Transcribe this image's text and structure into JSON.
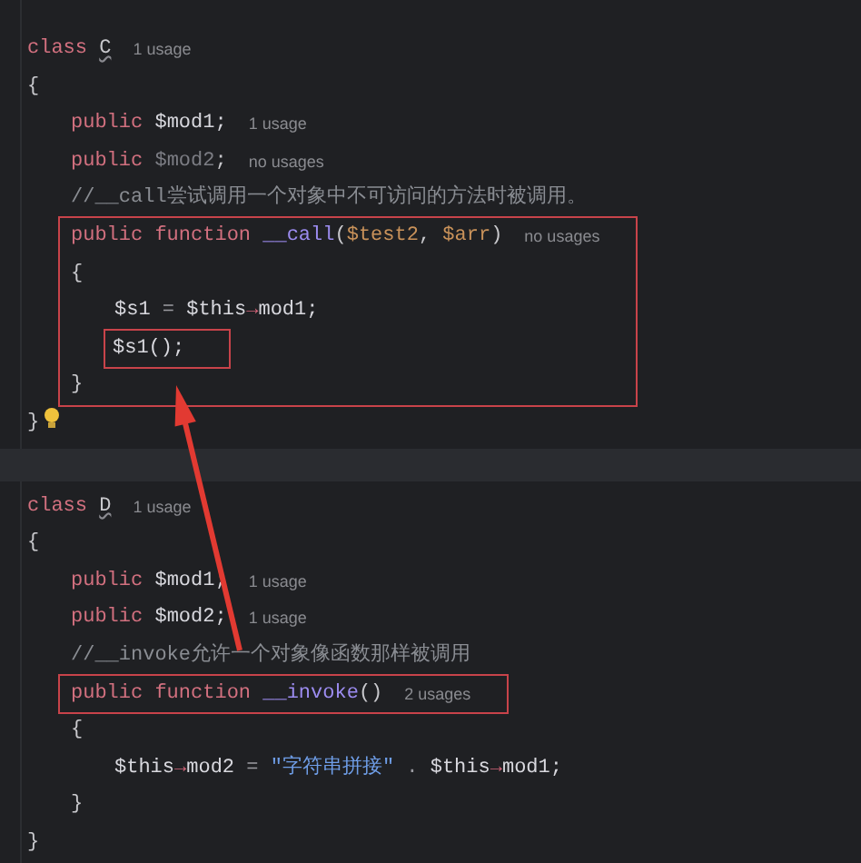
{
  "editor": {
    "blocks": [
      {
        "lines": [
          {
            "tokens": [
              {
                "kind": "keyword",
                "text": "class "
              },
              {
                "kind": "class_name",
                "text": "C"
              }
            ],
            "hint": "1 usage"
          },
          {
            "tokens": [
              {
                "kind": "plain",
                "text": "{"
              }
            ],
            "children": [
              {
                "tokens": [
                  {
                    "kind": "keyword",
                    "text": "public "
                  },
                  {
                    "kind": "var",
                    "text": "$mod1;"
                  }
                ],
                "hint": "1 usage"
              },
              {
                "tokens": [
                  {
                    "kind": "keyword",
                    "text": "public "
                  },
                  {
                    "kind": "unused",
                    "text": "$mod2"
                  },
                  {
                    "kind": "plain",
                    "text": ";"
                  }
                ],
                "hint": "no usages"
              },
              {
                "tokens": [
                  {
                    "kind": "comment",
                    "text": "//__call尝试调用一个对象中不可访问的方法时被调用。"
                  }
                ]
              },
              {
                "kind": "frame",
                "lines": [
                  {
                    "tokens": [
                      {
                        "kind": "keyword",
                        "text": "public function "
                      },
                      {
                        "kind": "function",
                        "text": "__call"
                      },
                      {
                        "kind": "plain",
                        "text": "("
                      },
                      {
                        "kind": "param",
                        "text": "$test2"
                      },
                      {
                        "kind": "plain",
                        "text": ", "
                      },
                      {
                        "kind": "param",
                        "text": "$arr"
                      },
                      {
                        "kind": "plain",
                        "text": ")"
                      }
                    ],
                    "hint": "no usages"
                  },
                  {
                    "tokens": [
                      {
                        "kind": "plain",
                        "text": "{"
                      }
                    ],
                    "children": [
                      {
                        "tokens": [
                          {
                            "kind": "var",
                            "text": "$s1 "
                          },
                          {
                            "kind": "operator",
                            "text": "= "
                          },
                          {
                            "kind": "var",
                            "text": "$this"
                          },
                          {
                            "kind": "arrow",
                            "text": "→"
                          },
                          {
                            "kind": "var",
                            "text": "mod1;"
                          }
                        ]
                      },
                      {
                        "tokens": [
                          {
                            "kind": "var",
                            "text": "$s1();"
                          }
                        ],
                        "boxed": true
                      }
                    ]
                  },
                  {
                    "tokens": [
                      {
                        "kind": "plain",
                        "text": "}"
                      }
                    ]
                  }
                ]
              }
            ]
          },
          {
            "tokens": [
              {
                "kind": "plain",
                "text": "}"
              }
            ],
            "bulb": true
          }
        ]
      },
      {
        "lines": [
          {
            "tokens": [
              {
                "kind": "keyword",
                "text": "class "
              },
              {
                "kind": "class_name",
                "text": "D"
              }
            ],
            "hint": "1 usage"
          },
          {
            "tokens": [
              {
                "kind": "plain",
                "text": "{"
              }
            ],
            "children": [
              {
                "tokens": [
                  {
                    "kind": "keyword",
                    "text": "public "
                  },
                  {
                    "kind": "var",
                    "text": "$mod1;"
                  }
                ],
                "hint": "1 usage"
              },
              {
                "tokens": [
                  {
                    "kind": "keyword",
                    "text": "public "
                  },
                  {
                    "kind": "var",
                    "text": "$mod2;"
                  }
                ],
                "hint": "1 usage"
              },
              {
                "tokens": [
                  {
                    "kind": "comment",
                    "text": "//__invoke允许一个对象像函数那样被调用"
                  }
                ]
              },
              {
                "kind": "frame",
                "lines": [
                  {
                    "tokens": [
                      {
                        "kind": "keyword",
                        "text": "public function "
                      },
                      {
                        "kind": "function",
                        "text": "__invoke"
                      },
                      {
                        "kind": "plain",
                        "text": "()"
                      }
                    ],
                    "hint": "2 usages"
                  }
                ]
              },
              {
                "tokens": [
                  {
                    "kind": "plain",
                    "text": "{"
                  }
                ],
                "children": [
                  {
                    "tokens": [
                      {
                        "kind": "var",
                        "text": "$this"
                      },
                      {
                        "kind": "arrow",
                        "text": "→"
                      },
                      {
                        "kind": "var",
                        "text": "mod2 "
                      },
                      {
                        "kind": "operator",
                        "text": "= "
                      },
                      {
                        "kind": "string",
                        "text": "\"字符串拼接\""
                      },
                      {
                        "kind": "operator",
                        "text": " . "
                      },
                      {
                        "kind": "var",
                        "text": "$this"
                      },
                      {
                        "kind": "arrow",
                        "text": "→"
                      },
                      {
                        "kind": "var",
                        "text": "mod1;"
                      }
                    ]
                  }
                ]
              },
              {
                "tokens": [
                  {
                    "kind": "plain",
                    "text": "}"
                  }
                ]
              }
            ]
          },
          {
            "tokens": [
              {
                "kind": "plain",
                "text": "}"
              }
            ]
          }
        ]
      }
    ]
  }
}
